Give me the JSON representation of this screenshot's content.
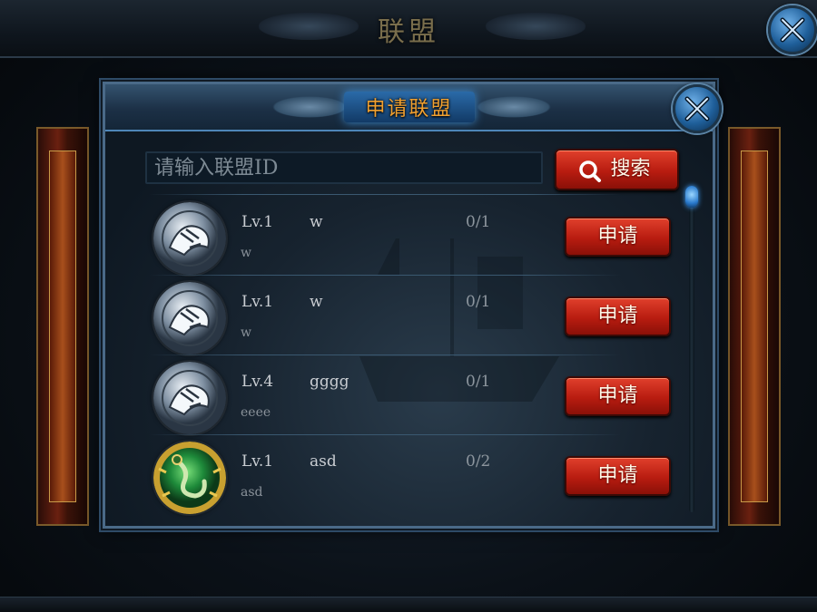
{
  "screen": {
    "title": "联盟",
    "close_icon": "crossed-swords-close-icon"
  },
  "dialog": {
    "title": "申请联盟",
    "close_icon": "crossed-swords-close-icon",
    "search": {
      "placeholder": "请输入联盟ID",
      "value": "",
      "button_label": "搜索",
      "button_icon": "magnifier-icon"
    },
    "alliances": [
      {
        "level": "Lv.1",
        "name": "w",
        "members": "0/1",
        "description": "w",
        "emblem": "white-tiger",
        "apply_label": "申请"
      },
      {
        "level": "Lv.1",
        "name": "w",
        "members": "0/1",
        "description": "w",
        "emblem": "white-tiger",
        "apply_label": "申请"
      },
      {
        "level": "Lv.4",
        "name": "gggg",
        "members": "0/1",
        "description": "eeee",
        "emblem": "white-tiger",
        "apply_label": "申请"
      },
      {
        "level": "Lv.1",
        "name": "asd",
        "members": "0/2",
        "description": "asd",
        "emblem": "green-dragon",
        "apply_label": "申请"
      }
    ]
  },
  "colors": {
    "title_gold": "#f0a030",
    "button_red": "#c8281a",
    "frame_blue": "#4a6a88"
  }
}
